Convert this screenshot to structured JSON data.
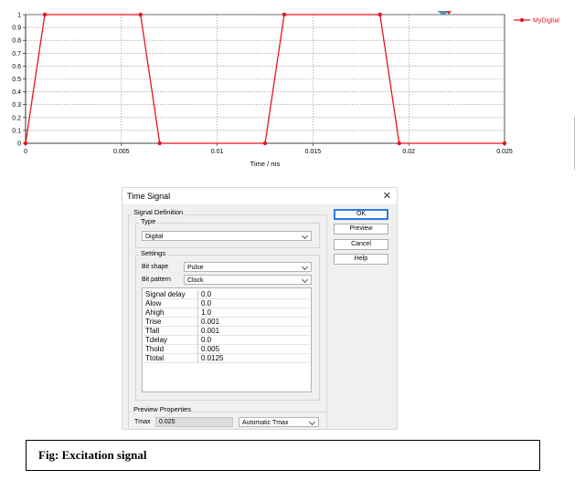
{
  "chart_data": {
    "type": "line",
    "xlabel": "Time / ms",
    "ylabel": "",
    "xlim": [
      0,
      0.025
    ],
    "ylim": [
      0,
      1
    ],
    "x_ticks": [
      "0",
      "0.005",
      "0.01",
      "0.015",
      "0.02",
      "0.025"
    ],
    "y_ticks": [
      "0",
      "0.1",
      "0.2",
      "0.3",
      "0.4",
      "0.5",
      "0.6",
      "0.7",
      "0.8",
      "0.9",
      "1"
    ],
    "grid": true,
    "legend_placement": "top-right",
    "series": [
      {
        "name": "MyDigital",
        "color": "#e8141c",
        "x": [
          0,
          0.001,
          0.006,
          0.007,
          0.0125,
          0.0135,
          0.0185,
          0.0195,
          0.025
        ],
        "y": [
          0,
          1,
          1,
          0,
          0,
          1,
          1,
          0,
          0
        ]
      }
    ]
  },
  "dialog": {
    "title": "Time Signal",
    "close_icon": "close-icon",
    "signal_definition": {
      "label": "Signal Definition",
      "type_label": "Type",
      "type_value": "Digital"
    },
    "settings": {
      "label": "Settings",
      "bit_shape_label": "Bit shape",
      "bit_shape_value": "Pulse",
      "bit_pattern_label": "Bit pattern",
      "bit_pattern_value": "Clock"
    },
    "params": [
      {
        "name": "Signal delay",
        "value": "0.0"
      },
      {
        "name": "Alow",
        "value": "0.0"
      },
      {
        "name": "Ahigh",
        "value": "1.0"
      },
      {
        "name": "Trise",
        "value": "0.001"
      },
      {
        "name": "Tfall",
        "value": "0.001"
      },
      {
        "name": "Tdelay",
        "value": "0.0"
      },
      {
        "name": "Thold",
        "value": "0.005"
      },
      {
        "name": "Ttotal",
        "value": "0.0125"
      }
    ],
    "preview_properties": {
      "label": "Preview Properties",
      "tmax_label": "Tmax",
      "tmax_value": "0.025",
      "tmax_mode": "Automatic Tmax"
    },
    "buttons": {
      "ok": "OK",
      "preview": "Preview",
      "cancel": "Cancel",
      "help": "Help"
    }
  },
  "caption": "Fig: Excitation signal",
  "colors": {
    "series": "#e8141c",
    "ok_border": "#2c7be5"
  }
}
